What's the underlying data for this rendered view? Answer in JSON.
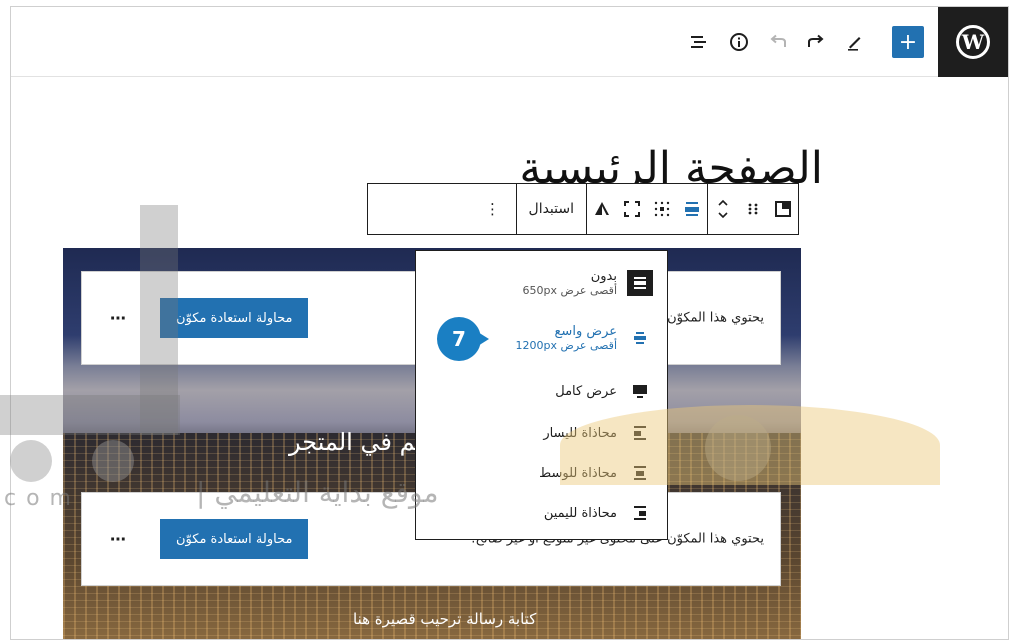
{
  "topbar": {
    "logo": "W",
    "add_button": "+",
    "icons": [
      "plus-icon",
      "pen-icon",
      "redo-icon",
      "undo-icon",
      "info-icon",
      "list-view-icon"
    ]
  },
  "page": {
    "title": "الصفحة الرئيسية"
  },
  "block_toolbar": {
    "replace_label": "استبدال",
    "more_label": "⋮"
  },
  "cover": {
    "heading": "مرحبًا بكم في المتجر",
    "caption": "كتابة رسالة ترحيب قصيرة هنا",
    "notice_1": {
      "message": "يحتوي هذا المكوّن على محتوى غير متوقع أو غير صالح.",
      "recover_label": "محاولة استعادة مكوّن",
      "more_label": "⋯"
    },
    "notice_2": {
      "message": "يحتوي هذا المكوّن على محتوى غير متوقع أو غير صالح.",
      "recover_label": "محاولة استعادة مكوّن",
      "more_label": "⋯"
    }
  },
  "dropdown": {
    "items": [
      {
        "label": "بدون",
        "sub": "أقصى عرض 650px",
        "icon": "align-none-icon"
      },
      {
        "label": "عرض واسع",
        "sub": "أقصى عرض 1200px",
        "icon": "align-wide-icon",
        "selected": true
      },
      {
        "label": "عرض كامل",
        "sub": "",
        "icon": "align-full-icon"
      },
      {
        "label": "محاذاة لليسار",
        "sub": "",
        "icon": "align-left-icon"
      },
      {
        "label": "محاذاة للوسط",
        "sub": "",
        "icon": "align-center-icon"
      },
      {
        "label": "محاذاة لليمين",
        "sub": "",
        "icon": "align-right-icon"
      }
    ]
  },
  "step_marker": "7",
  "watermark": {
    "text": "موقع بداية التعليمي",
    "separator": "|",
    "latin": "com"
  },
  "colors": {
    "accent": "#2271b1",
    "marker": "#1a7fc3",
    "dark": "#1e1e1e"
  }
}
